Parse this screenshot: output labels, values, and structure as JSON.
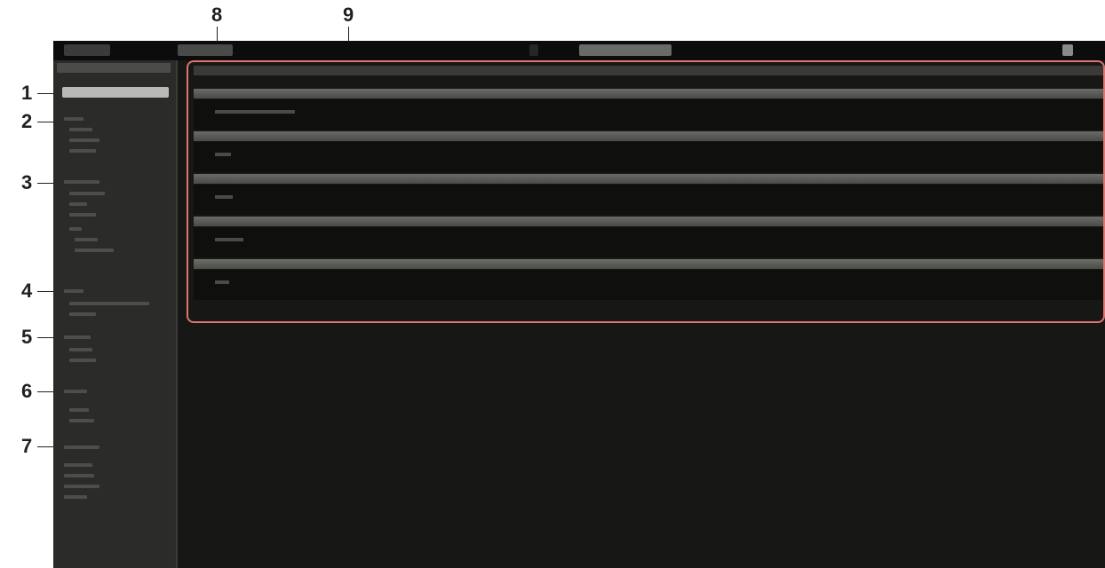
{
  "callouts": [
    "1",
    "2",
    "3",
    "4",
    "5",
    "6",
    "7",
    "8",
    "9"
  ],
  "topbar": {
    "left_btn": "",
    "tab_btn": "",
    "center_btn": "",
    "right_icon": "close-icon"
  },
  "sidebar": {
    "header": "",
    "items": [
      "",
      "",
      "",
      "",
      "",
      "",
      "",
      "",
      "",
      "",
      "",
      "",
      "",
      "",
      "",
      "",
      "",
      "",
      "",
      "",
      "",
      "",
      "",
      "",
      "",
      "",
      "",
      ""
    ]
  },
  "main": {
    "title_bar": "",
    "sections": [
      {
        "header": "",
        "value": ""
      },
      {
        "header": "",
        "value": ""
      },
      {
        "header": "",
        "value": ""
      },
      {
        "header": "",
        "value": ""
      },
      {
        "header": "",
        "value": ""
      }
    ]
  },
  "colors": {
    "callout_outline": "#e0746f",
    "app_background": "#161614",
    "sidebar_background": "#2b2b2a",
    "section_header": "#5a5a58"
  }
}
